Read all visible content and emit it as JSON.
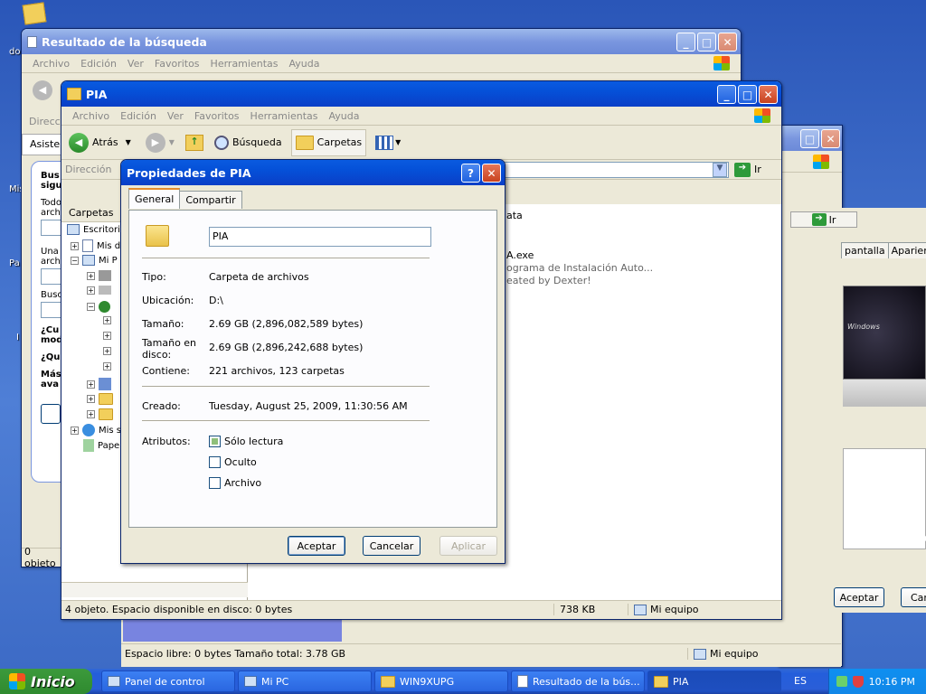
{
  "search_window": {
    "title": "Resultado de la búsqueda",
    "menu": [
      "Archivo",
      "Edición",
      "Ver",
      "Favoritos",
      "Herramientas",
      "Ayuda"
    ],
    "side": {
      "direccion": "Direcci",
      "asistente": "Asisten",
      "busca": "Bus",
      "sigue": "sigu",
      "todo": "Todo",
      "arch": "arch",
      "una": "Una",
      "busc": "Busc",
      "cu": "¿Cu",
      "mod": "mod",
      "qu": "¿Qu",
      "mas": "Más",
      "ava": "ava"
    },
    "status": "0 objeto"
  },
  "back_window": {
    "tabs": [
      "pantalla",
      "Aparienci"
    ],
    "ir": "Ir",
    "accept": "Aceptar",
    "cancel": "Can",
    "status_free": "Espacio libre: 0 bytes Tamaño total: 3.78 GB",
    "status_pc": "Mi equipo"
  },
  "pia_window": {
    "title": "PIA",
    "menu": [
      "Archivo",
      "Edición",
      "Ver",
      "Favoritos",
      "Herramientas",
      "Ayuda"
    ],
    "toolbar": {
      "back": "Atrás",
      "search": "Búsqueda",
      "folders": "Carpetas"
    },
    "address_label": "Dirección",
    "go": "Ir",
    "folders_panel": "Carpetas",
    "tree": [
      "Escritori",
      "Mis d",
      "Mi P",
      "",
      "",
      "",
      "",
      "",
      "",
      "",
      "",
      "",
      "",
      "Mis s",
      "Pape"
    ],
    "files": {
      "name1": "ata",
      "name2": "A.exe",
      "desc": "ograma de Instalación Auto...",
      "author": "eated by Dexter!"
    },
    "status": {
      "objects": "4 objeto. Espacio disponible en disco:  0 bytes",
      "size": "738 KB",
      "computer": "Mi equipo"
    }
  },
  "dialog": {
    "title": "Propiedades de PIA",
    "tabs": [
      "General",
      "Compartir"
    ],
    "name": "PIA",
    "fields": [
      {
        "k": "Tipo:",
        "v": "Carpeta de archivos"
      },
      {
        "k": "Ubicación:",
        "v": "D:\\"
      },
      {
        "k": "Tamaño:",
        "v": "2.69 GB (2,896,082,589 bytes)"
      },
      {
        "k": "Tamaño en disco:",
        "v": "2.69 GB (2,896,242,688 bytes)"
      },
      {
        "k": "Contiene:",
        "v": "221 archivos, 123 carpetas"
      },
      {
        "k": "Creado:",
        "v": "Tuesday, August 25, 2009, 11:30:56 AM"
      }
    ],
    "attributes_label": "Atributos:",
    "attributes": [
      {
        "label": "Sólo lectura",
        "checked": true
      },
      {
        "label": "Oculto",
        "checked": false
      },
      {
        "label": "Archivo",
        "checked": false
      }
    ],
    "buttons": {
      "ok": "Aceptar",
      "cancel": "Cancelar",
      "apply": "Aplicar"
    }
  },
  "desktop": {
    "label1": "do",
    "label2": "Mis",
    "label3": "Pa",
    "label4": "I"
  },
  "taskbar": {
    "start": "Inicio",
    "tasks": [
      "Panel de control",
      "Mi PC",
      "WIN9XUPG",
      "Resultado de la bús...",
      "PIA"
    ],
    "lang": "ES",
    "clock": "10:16 PM"
  }
}
